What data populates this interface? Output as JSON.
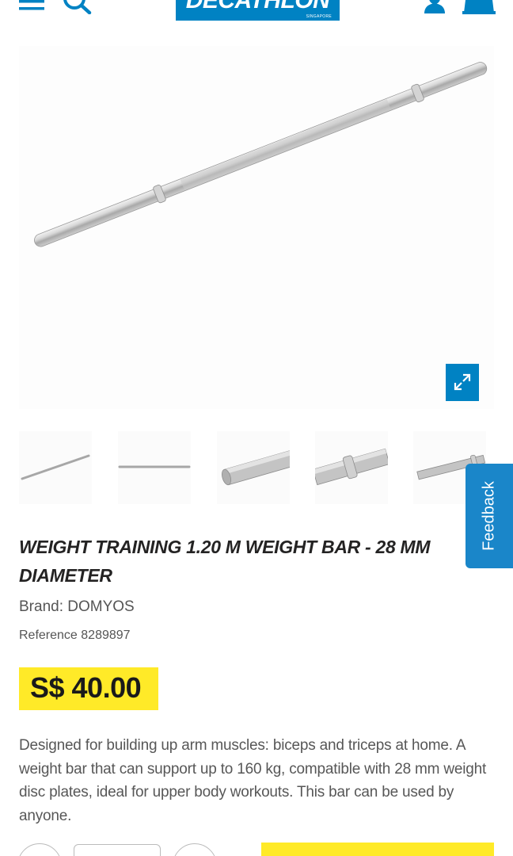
{
  "header": {
    "logo_text": "DECATHLON",
    "logo_subtext": "SINGAPORE",
    "icons": [
      "menu-icon",
      "search-icon",
      "user-icon",
      "cart-icon"
    ],
    "brand_color": "#0082c3"
  },
  "gallery": {
    "thumbnail_count": 5,
    "zoom_icon": "expand-icon"
  },
  "feedback": {
    "label": "Feedback"
  },
  "product": {
    "title": "WEIGHT TRAINING 1.20 M WEIGHT BAR - 28 MM DIAMETER",
    "brand": "Brand: DOMYOS",
    "reference": "Reference 8289897",
    "price": "S$ 40.00",
    "price_color": "#ffea28",
    "description": "Designed for building up arm muscles: biceps and triceps at home. A weight bar that can support up to 160 kg, compatible with 28 mm weight disc plates, ideal for upper body workouts. This bar can be used by anyone."
  }
}
